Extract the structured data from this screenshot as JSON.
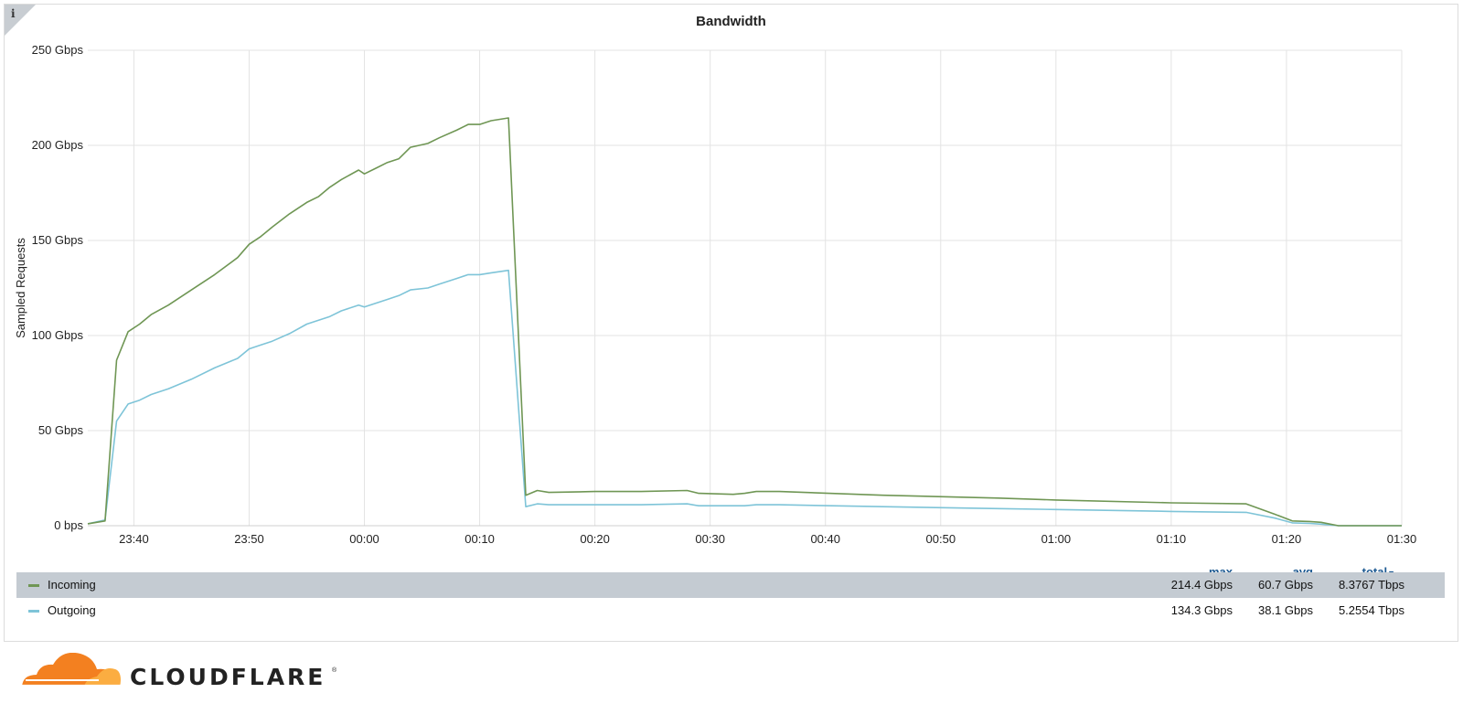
{
  "chart_data": {
    "type": "line",
    "title": "Bandwidth",
    "ylabel": "Sampled Requests",
    "xlabel": "",
    "y_unit": "Gbps",
    "ylim": [
      0,
      250
    ],
    "yticks": [
      0,
      50,
      100,
      150,
      200,
      250
    ],
    "ytick_labels": [
      "0 bps",
      "50 Gbps",
      "100 Gbps",
      "150 Gbps",
      "200 Gbps",
      "250 Gbps"
    ],
    "xlim": [
      "23:36",
      "01:30"
    ],
    "xticks": [
      "23:40",
      "23:50",
      "00:00",
      "00:10",
      "00:20",
      "00:30",
      "00:40",
      "00:50",
      "01:00",
      "01:10",
      "01:20",
      "01:30"
    ],
    "grid": true,
    "series": [
      {
        "name": "Incoming",
        "color": "#6f9654",
        "points": [
          [
            "23:36",
            1
          ],
          [
            "23:37.5",
            2.5
          ],
          [
            "23:38.5",
            87
          ],
          [
            "23:39.5",
            102
          ],
          [
            "23:40.5",
            106
          ],
          [
            "23:41.5",
            111
          ],
          [
            "23:43",
            116
          ],
          [
            "23:45",
            124
          ],
          [
            "23:47",
            132
          ],
          [
            "23:49",
            141
          ],
          [
            "23:50",
            148
          ],
          [
            "23:51",
            152
          ],
          [
            "23:52",
            157
          ],
          [
            "23:53.5",
            164
          ],
          [
            "23:55",
            170
          ],
          [
            "23:56",
            173
          ],
          [
            "23:57",
            178
          ],
          [
            "23:58",
            182
          ],
          [
            "23:59.5",
            187
          ],
          [
            "00:00",
            185
          ],
          [
            "00:01",
            188
          ],
          [
            "00:02",
            191
          ],
          [
            "00:03",
            193
          ],
          [
            "00:04",
            199
          ],
          [
            "00:05.5",
            201
          ],
          [
            "00:06.5",
            204
          ],
          [
            "00:08",
            208
          ],
          [
            "00:09",
            211
          ],
          [
            "00:10",
            211
          ],
          [
            "00:11",
            213
          ],
          [
            "00:12.5",
            214.4
          ],
          [
            "00:14",
            16
          ],
          [
            "00:15",
            18.5
          ],
          [
            "00:16",
            17.5
          ],
          [
            "00:20",
            18
          ],
          [
            "00:24",
            18
          ],
          [
            "00:28",
            18.5
          ],
          [
            "00:29",
            17
          ],
          [
            "00:32",
            16.5
          ],
          [
            "00:33",
            17
          ],
          [
            "00:34",
            18
          ],
          [
            "00:36",
            18
          ],
          [
            "00:45",
            16
          ],
          [
            "00:55",
            14.5
          ],
          [
            "01:00",
            13.5
          ],
          [
            "01:10",
            12
          ],
          [
            "01:16.5",
            11.5
          ],
          [
            "01:19",
            6
          ],
          [
            "01:20.5",
            2.5
          ],
          [
            "01:22",
            2.2
          ],
          [
            "01:23",
            1.8
          ],
          [
            "01:24.5",
            0
          ],
          [
            "01:30",
            0
          ]
        ]
      },
      {
        "name": "Outgoing",
        "color": "#7ec4d8",
        "points": [
          [
            "23:36",
            1
          ],
          [
            "23:37.5",
            3
          ],
          [
            "23:38.5",
            55
          ],
          [
            "23:39.5",
            64
          ],
          [
            "23:40.5",
            66
          ],
          [
            "23:41.5",
            69
          ],
          [
            "23:43",
            72
          ],
          [
            "23:45",
            77
          ],
          [
            "23:47",
            83
          ],
          [
            "23:49",
            88
          ],
          [
            "23:50",
            93
          ],
          [
            "23:51",
            95
          ],
          [
            "23:52",
            97
          ],
          [
            "23:53.5",
            101
          ],
          [
            "23:55",
            106
          ],
          [
            "23:56",
            108
          ],
          [
            "23:57",
            110
          ],
          [
            "23:58",
            113
          ],
          [
            "23:59.5",
            116
          ],
          [
            "00:00",
            115
          ],
          [
            "00:01",
            117
          ],
          [
            "00:02",
            119
          ],
          [
            "00:03",
            121
          ],
          [
            "00:04",
            124
          ],
          [
            "00:05.5",
            125
          ],
          [
            "00:06.5",
            127
          ],
          [
            "00:08",
            130
          ],
          [
            "00:09",
            132
          ],
          [
            "00:10",
            132
          ],
          [
            "00:11",
            133
          ],
          [
            "00:12.5",
            134.3
          ],
          [
            "00:14",
            10
          ],
          [
            "00:15",
            11.5
          ],
          [
            "00:16",
            11
          ],
          [
            "00:20",
            11
          ],
          [
            "00:24",
            11
          ],
          [
            "00:28",
            11.5
          ],
          [
            "00:29",
            10.5
          ],
          [
            "00:32",
            10.5
          ],
          [
            "00:33",
            10.5
          ],
          [
            "00:34",
            11
          ],
          [
            "00:36",
            11
          ],
          [
            "00:45",
            10
          ],
          [
            "00:55",
            9
          ],
          [
            "01:00",
            8.5
          ],
          [
            "01:10",
            7.5
          ],
          [
            "01:16.5",
            7
          ],
          [
            "01:19",
            4
          ],
          [
            "01:20.5",
            1.5
          ],
          [
            "01:22",
            1.2
          ],
          [
            "01:23",
            0.8
          ],
          [
            "01:24.5",
            0
          ],
          [
            "01:30",
            0
          ]
        ]
      }
    ]
  },
  "legend": {
    "headers": {
      "max": "max",
      "avg": "avg",
      "total": "total"
    },
    "sort_indicator_icon": "caret-down-icon",
    "rows": [
      {
        "name": "Incoming",
        "color": "#6f9654",
        "max": "214.4 Gbps",
        "avg": "60.7 Gbps",
        "total": "8.3767 Tbps",
        "selected": true
      },
      {
        "name": "Outgoing",
        "color": "#7ec4d8",
        "max": "134.3 Gbps",
        "avg": "38.1 Gbps",
        "total": "5.2554 Tbps",
        "selected": false
      }
    ]
  },
  "info_icon": {
    "icon": "info-icon",
    "glyph": "i"
  },
  "brand": {
    "name": "CLOUDFLARE",
    "registered_mark": "®",
    "cloud_color": "#f38020",
    "cloud_light_color": "#fbad41"
  }
}
